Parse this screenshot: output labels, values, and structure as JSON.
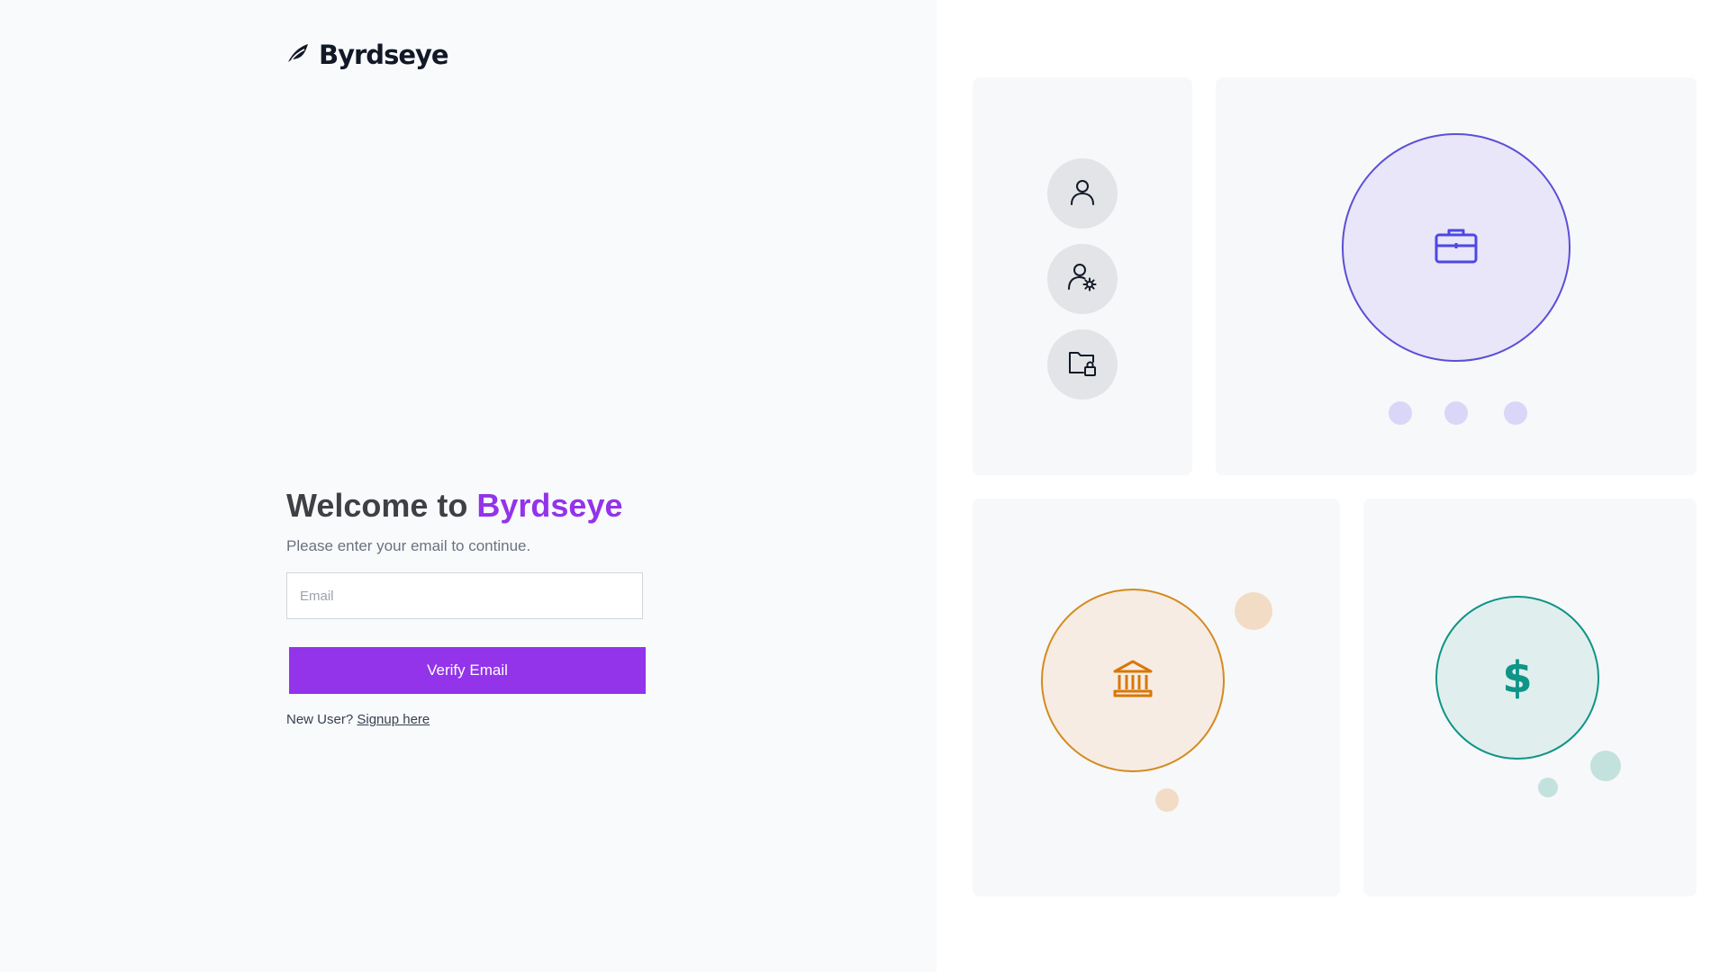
{
  "brand": {
    "logo_text": "Byrdseye",
    "logo_icon": "bird-icon"
  },
  "login": {
    "title_prefix": "Welcome to",
    "title_brand": "Byrdseye",
    "subtitle": "Please enter your email to continue.",
    "email_placeholder": "Email",
    "email_value": "",
    "verify_label": "Verify Email",
    "new_user_text": "New User?",
    "signup_label": "Signup here"
  },
  "illustration": {
    "card_1_icons": [
      "user-icon",
      "user-settings-icon",
      "folder-lock-icon"
    ],
    "card_2_icon": "briefcase-icon",
    "card_3_icon": "bank-icon",
    "card_4_icon": "dollar-icon",
    "card_4_symbol": "$"
  },
  "colors": {
    "accent": "#9333ea",
    "indigo": "#5b4fd6",
    "orange": "#d58a1e",
    "teal": "#0f9488"
  }
}
